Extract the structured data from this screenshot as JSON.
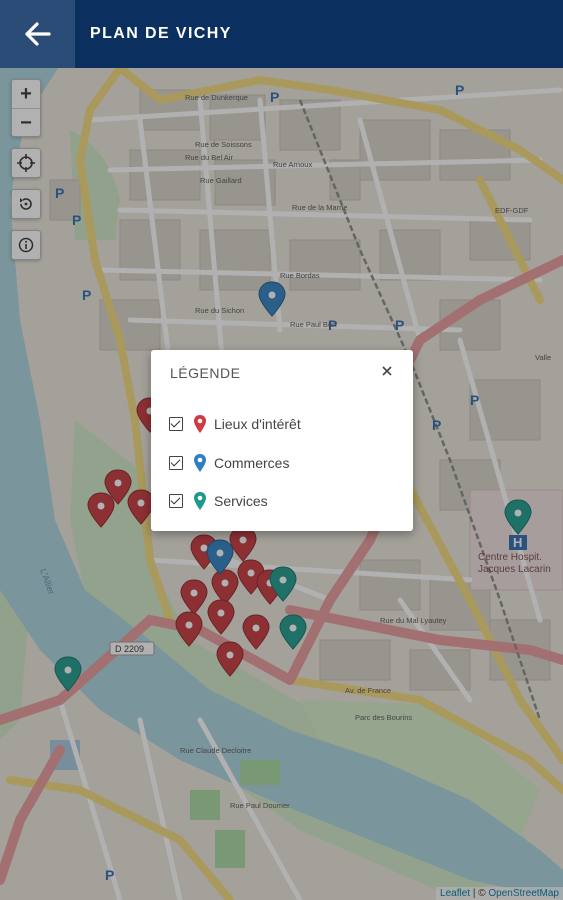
{
  "header": {
    "title": "PLAN DE VICHY",
    "back_icon": "arrow-left-icon",
    "bg_color": "#0b2f5e"
  },
  "map_controls": {
    "zoom_in": "+",
    "zoom_out": "−",
    "locate_icon": "crosshair-icon",
    "reset_icon": "rotate-icon",
    "info_icon": "info-icon"
  },
  "map_labels": {
    "rue_dunkerque": "Rue de Dunkerque",
    "rue_soissons": "Rue de Soissons",
    "rue_bel_air": "Rue du Bel Air",
    "rue_gaillard": "Rue Gaillard",
    "rue_arnoux": "Rue Arnoux",
    "rue_marne": "Rue de la Marne",
    "rue_sichon": "Rue du Sichon",
    "rue_bordas": "Rue Bordas",
    "rue_paul_bert": "Rue Paul Bert",
    "rue_mal_lyautey": "Rue du Mal Lyautey",
    "rue_de_france": "Av. de France",
    "parc_bourins": "Parc des Bourins",
    "centre_hosp": "Centre Hospit.",
    "jacques_lacarin": "Jacques Lacarin",
    "d2209": "D 2209",
    "allier": "L'Allier",
    "edf": "EDF-GDF",
    "valle": "Valle",
    "rue_claude_decloitre": "Rue Claude Decloitre",
    "rue_paul_doumer": "Rue Paul Doumer"
  },
  "legend": {
    "title": "LÉGENDE",
    "close_icon": "close-icon",
    "items": [
      {
        "label": "Lieux d'intérêt",
        "color": "#d0393f",
        "checked": true
      },
      {
        "label": "Commerces",
        "color": "#2d7fc1",
        "checked": true
      },
      {
        "label": "Services",
        "color": "#1c9a8a",
        "checked": true
      }
    ]
  },
  "attribution": {
    "leaflet": "Leaflet",
    "sep": " | © ",
    "osm": "OpenStreetMap"
  }
}
